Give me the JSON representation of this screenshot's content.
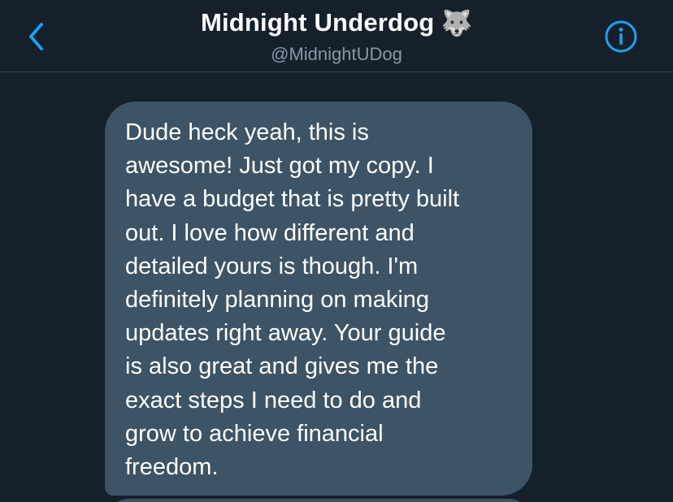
{
  "header": {
    "title": "Midnight Underdog",
    "title_emoji": "🐺",
    "handle": "@MidnightUDog",
    "back_icon": "chevron-left-icon",
    "info_icon": "info-circle-icon",
    "accent_color": "#1da1f2"
  },
  "conversation": {
    "message": {
      "lines": [
        "Dude heck yeah, this is",
        "awesome! Just got my copy. I",
        "have a budget that is pretty built",
        "out. I love how different and",
        "detailed yours is though. I'm",
        "definitely planning on making",
        "updates right away. Your guide",
        "is also great and gives me the",
        "exact steps I need to do and",
        "grow to achieve financial",
        "freedom."
      ],
      "bubble_color": "#3d5466"
    }
  },
  "theme": {
    "background": "#15202b",
    "divider": "#38444d",
    "secondary_text": "#8899a6"
  }
}
